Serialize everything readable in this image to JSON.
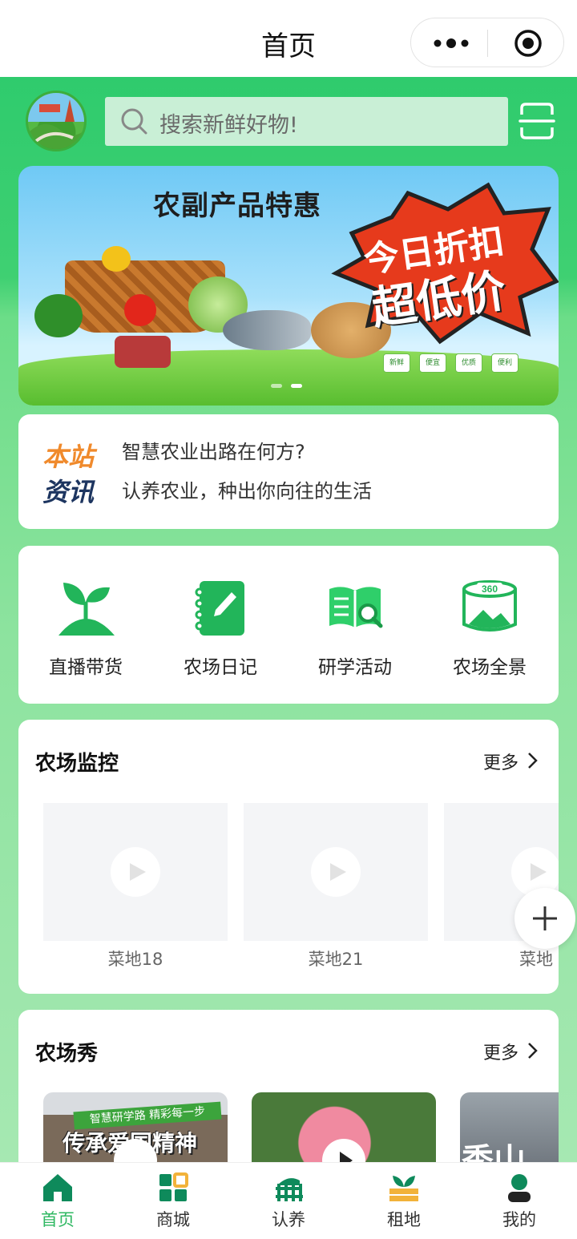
{
  "titlebar": {
    "title": "首页"
  },
  "search": {
    "placeholder": "搜索新鲜好物!"
  },
  "banner": {
    "title": "农副产品特惠",
    "burst_line1": "今日折扣",
    "burst_line2": "超低价",
    "badges": [
      "新鲜",
      "便宜",
      "优质",
      "便利"
    ]
  },
  "news": {
    "label_top": "本站",
    "label_bottom": "资讯",
    "items": [
      "智慧农业出路在何方?",
      "认养农业，种出你向往的生活"
    ]
  },
  "menu": {
    "items": [
      {
        "label": "直播带货",
        "icon": "sprout-icon"
      },
      {
        "label": "农场日记",
        "icon": "notebook-icon"
      },
      {
        "label": "研学活动",
        "icon": "book-search-icon"
      },
      {
        "label": "农场全景",
        "icon": "panorama-360-icon"
      }
    ]
  },
  "monitor": {
    "title": "农场监控",
    "more": "更多",
    "videos": [
      {
        "label": "菜地18"
      },
      {
        "label": "菜地21"
      },
      {
        "label": "菜地"
      }
    ]
  },
  "show": {
    "title": "农场秀",
    "more": "更多",
    "photos": [
      {
        "caption_top": "智慧研学路 精彩每一步",
        "caption_main": "传承爱国精神"
      },
      {
        "caption_top": "",
        "caption_main": ""
      },
      {
        "caption_top": "",
        "caption_main": "秀山"
      }
    ]
  },
  "tabbar": {
    "items": [
      {
        "label": "首页",
        "active": true
      },
      {
        "label": "商城",
        "active": false
      },
      {
        "label": "认养",
        "active": false
      },
      {
        "label": "租地",
        "active": false
      },
      {
        "label": "我的",
        "active": false
      }
    ]
  },
  "colors": {
    "brand_green": "#2fb862",
    "accent_orange": "#f08a2c",
    "navy": "#1d3560"
  }
}
